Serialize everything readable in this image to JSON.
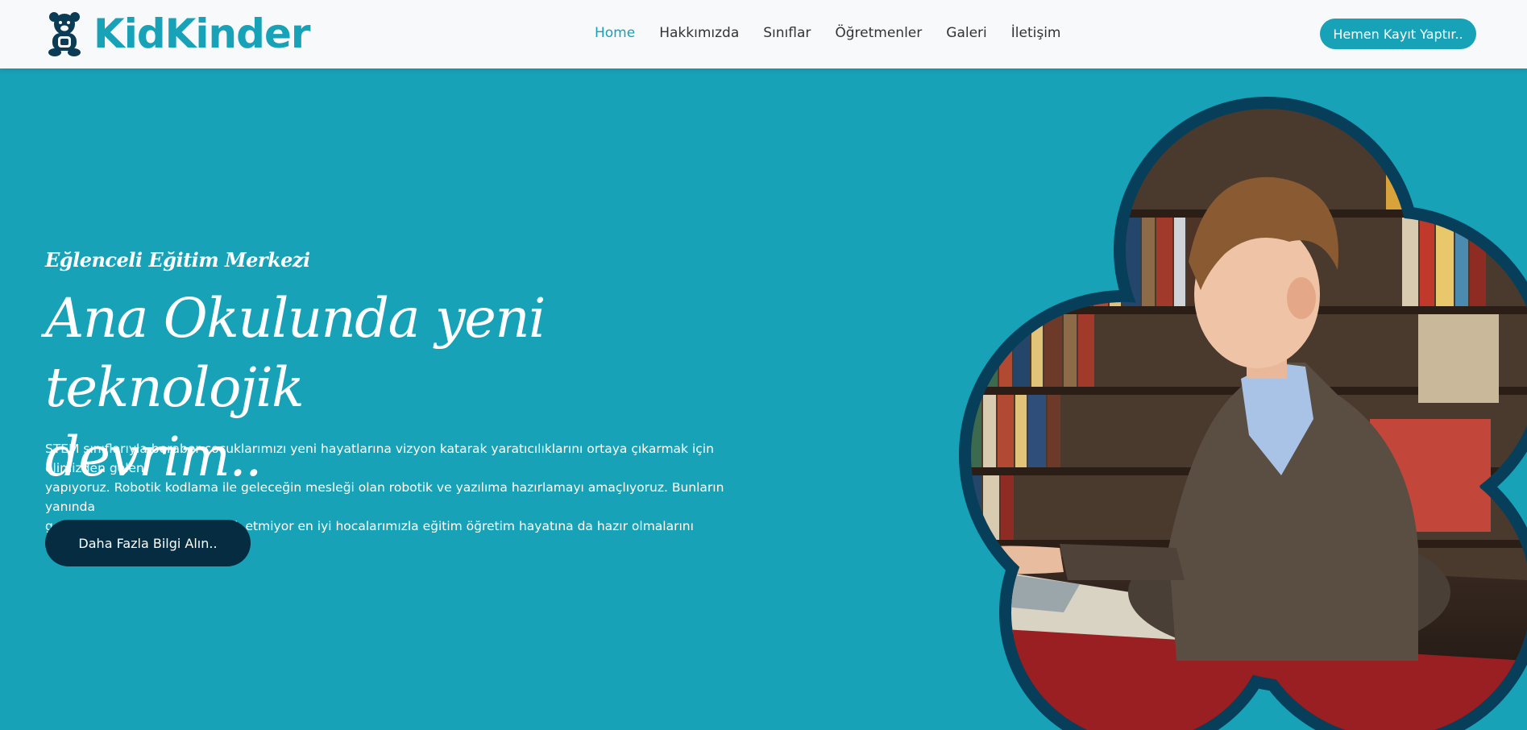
{
  "brand": {
    "name": "KidKinder",
    "icon": "teddy-bear-icon",
    "color": "#17a2b8"
  },
  "nav": {
    "items": [
      {
        "label": "Home",
        "active": true
      },
      {
        "label": "Hakkımızda",
        "active": false
      },
      {
        "label": "Sınıflar",
        "active": false
      },
      {
        "label": "Öğretmenler",
        "active": false
      },
      {
        "label": "Galeri",
        "active": false
      },
      {
        "label": "İletişim",
        "active": false
      }
    ],
    "cta_label": "Hemen Kayıt Yaptır.."
  },
  "hero": {
    "subtitle": "Eğlenceli Eğitim Merkezi",
    "title_line1": "Ana Okulunda yeni teknolojik",
    "title_line2": "devrim..",
    "text_line1": "STEM sınıflarıyla beraber çocuklarımızı yeni hayatlarına vizyon katarak yaratıcılıklarını ortaya çıkarmak için elimizden geleni",
    "text_line2": "yapıyoruz. Robotik kodlama ile geleceğin mesleği olan robotik ve yazılıma hazırlamayı amaçlıyoruz. Bunların yanında",
    "text_line3": "geleneksel eğitimleride gözardı etmiyor en iyi hocalarımızla eğitim öğretim hayatına da hazır olmalarını sağlıyoruz.",
    "button_label": "Daha Fazla Bilgi Alın..",
    "image": "boy-reading-book-in-library"
  },
  "colors": {
    "primary": "#17a2b8",
    "dark": "#052c40",
    "navbar_bg": "#f8f9fa",
    "text": "#ffffff"
  }
}
